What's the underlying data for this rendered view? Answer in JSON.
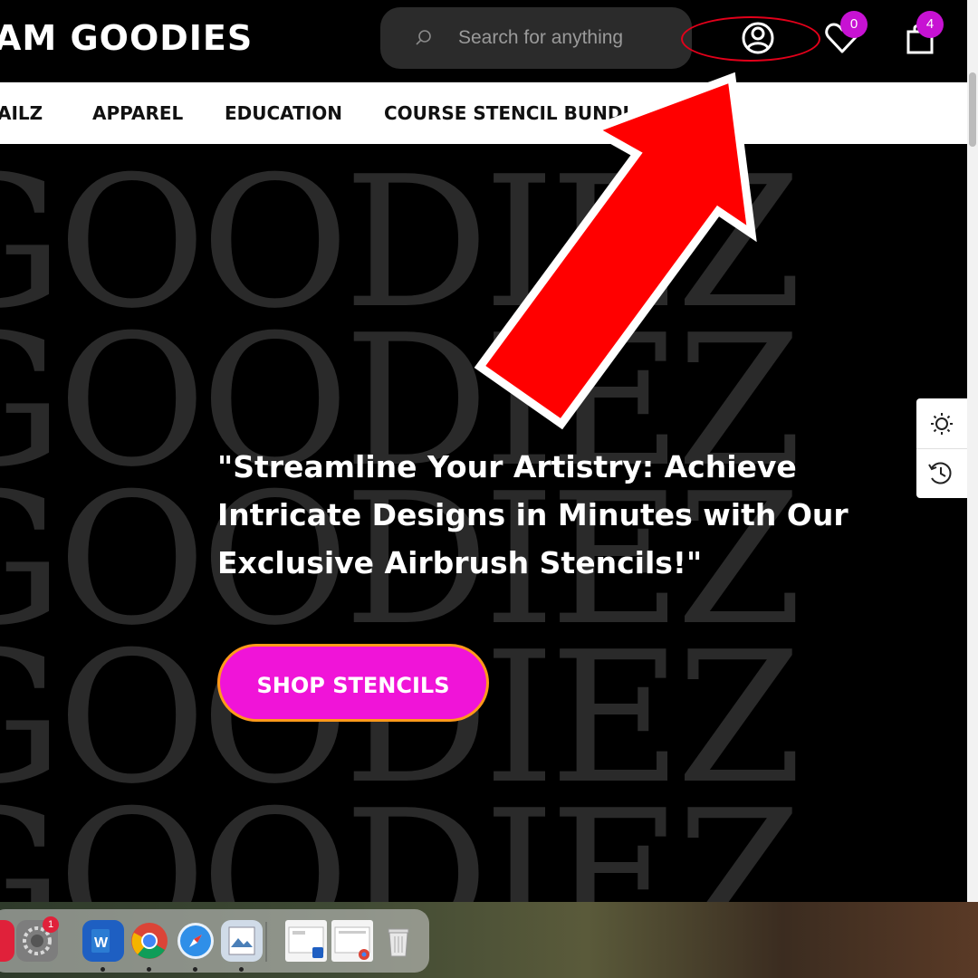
{
  "header": {
    "logo_text": "AM GOODIES",
    "search": {
      "placeholder": "Search for anything",
      "icon": "search-icon"
    },
    "account_icon": "account-icon",
    "wishlist": {
      "icon": "heart-icon",
      "count": "0"
    },
    "cart": {
      "icon": "shopping-bag-icon",
      "count": "4"
    }
  },
  "nav": {
    "items": [
      {
        "label": "AILZ"
      },
      {
        "label": "APPAREL"
      },
      {
        "label": "EDUCATION"
      },
      {
        "label": "COURSE STENCIL BUNDL"
      }
    ]
  },
  "hero": {
    "background_word": "GOODIEZ",
    "headline": "\"Streamline Your Artistry: Achieve Intricate Designs in Minutes with Our Exclusive Airbrush Stencils!\"",
    "cta_label": "SHOP STENCILS"
  },
  "side_tools": [
    {
      "icon": "sun-icon"
    },
    {
      "icon": "history-icon"
    }
  ],
  "dock": {
    "apps": [
      {
        "icon": "app-red-icon"
      },
      {
        "icon": "system-settings-icon",
        "badge": "1"
      },
      {
        "icon": "word-icon"
      },
      {
        "icon": "chrome-icon"
      },
      {
        "icon": "safari-icon"
      },
      {
        "icon": "preview-icon"
      },
      {
        "icon": "window-thumbnail-word-icon"
      },
      {
        "icon": "window-thumbnail-chrome-icon"
      },
      {
        "icon": "trash-icon"
      }
    ]
  },
  "colors": {
    "accent_pink": "#f014d8",
    "cta_border": "#ff9a1a",
    "badge": "#c712d3",
    "annotation_red": "#ff0000"
  }
}
